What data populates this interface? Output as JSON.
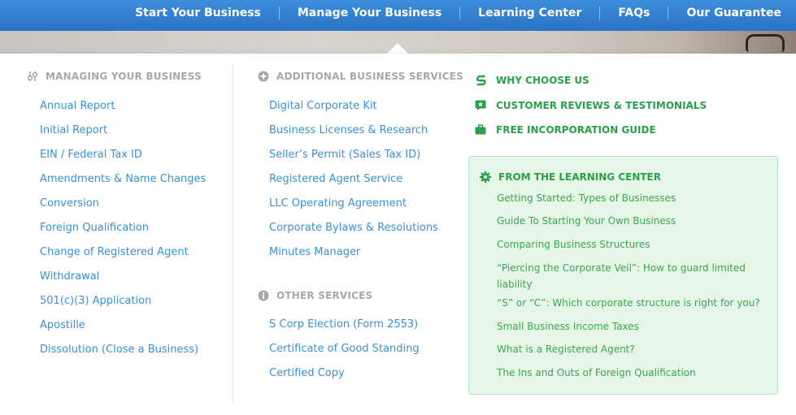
{
  "nav": {
    "items": [
      "Start Your Business",
      "Manage Your Business",
      "Learning Center",
      "FAQs",
      "Our Guarantee"
    ]
  },
  "colors": {
    "nav_bg": "#2f7ccd",
    "link_blue": "#3b8fd6",
    "heading_gray": "#a3a9b0",
    "accent_green": "#2aa04a",
    "learning_box_bg": "#e5f5e7"
  },
  "managing": {
    "icon": "sliders-icon",
    "heading": "MANAGING YOUR BUSINESS",
    "links": [
      "Annual Report",
      "Initial Report",
      "EIN / Federal Tax ID",
      "Amendments & Name Changes",
      "Conversion",
      "Foreign Qualification",
      "Change of Registered Agent",
      "Withdrawal",
      "501(c)(3) Application",
      "Apostille",
      "Dissolution (Close a Business)"
    ]
  },
  "additional": {
    "icon": "plus-circle-icon",
    "heading": "ADDITIONAL BUSINESS SERVICES",
    "links": [
      "Digital Corporate Kit",
      "Business Licenses & Research",
      "Seller’s Permit (Sales Tax ID)",
      "Registered Agent Service",
      "LLC Operating Agreement",
      "Corporate Bylaws & Resolutions",
      "Minutes Manager"
    ]
  },
  "other": {
    "icon": "info-circle-icon",
    "heading": "OTHER SERVICES",
    "links": [
      "S Corp Election (Form 2553)",
      "Certificate of Good Standing",
      "Certified Copy"
    ]
  },
  "why": {
    "items": [
      {
        "label": "WHY CHOOSE US",
        "icon": "s-logo-icon"
      },
      {
        "label": "CUSTOMER REVIEWS & TESTIMONIALS",
        "icon": "review-star-icon"
      },
      {
        "label": "FREE INCORPORATION GUIDE",
        "icon": "briefcase-icon"
      }
    ]
  },
  "learning": {
    "icon": "gear-icon",
    "heading": "FROM THE LEARNING CENTER",
    "links": [
      "Getting Started: Types of Businesses",
      "Guide To Starting Your Own Business",
      "Comparing Business Structures",
      "“Piercing the Corporate Veil”: How to guard limited liability",
      "“S” or “C”: Which corporate structure is right for you?",
      "Small Business Income Taxes",
      "What is a Registered Agent?",
      "The Ins and Outs of Foreign Qualification"
    ]
  }
}
